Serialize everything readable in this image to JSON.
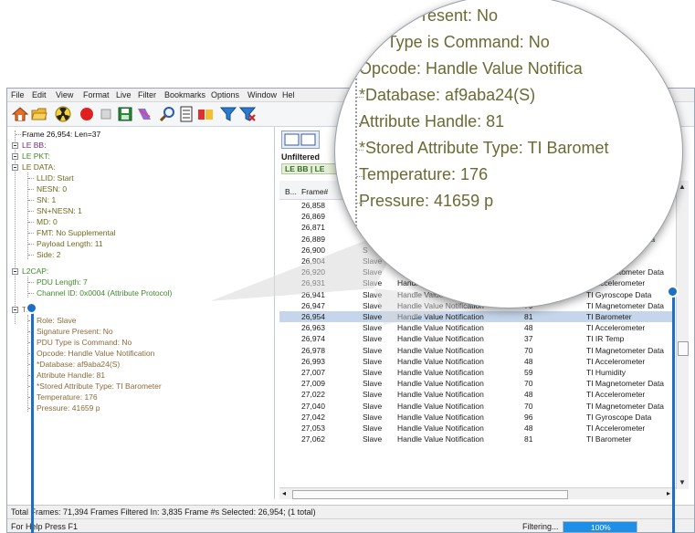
{
  "menu": [
    "File",
    "Edit",
    "View",
    "Format",
    "Live",
    "Filter",
    "Bookmarks",
    "Options",
    "Window",
    "Hel"
  ],
  "tree": {
    "frame": "Frame 26,954:  Len=37",
    "le_bb": "LE BB:",
    "le_pkt": "LE PKT:",
    "le_data": "LE DATA:",
    "le_data_children": [
      "LLID: Start",
      "NESN: 0",
      "SN: 1",
      "SN+NESN: 1",
      "MD: 0",
      "FMT: No Supplemental",
      "Payload Length: 11",
      "Side: 2"
    ],
    "l2cap": "L2CAP:",
    "l2cap_children": [
      "PDU Length: 7",
      "Channel ID: 0x0004  (Attribute Protocol)"
    ],
    "att": "T:",
    "att_children": [
      "Role: Slave",
      "Signature Present: No",
      "PDU Type is Command: No",
      "Opcode: Handle Value Notification",
      "*Database: af9aba24(S)",
      "Attribute Handle: 81",
      "*Stored Attribute Type: TI Barometer",
      "Temperature: 176",
      "Pressure: 41659 p"
    ]
  },
  "tabs": {
    "unfiltered": "Unfiltered",
    "sub": "LE BB | LE"
  },
  "grid": {
    "headers": {
      "b": "B...",
      "frame": "Frame#"
    },
    "rows": [
      {
        "frame": "26,858",
        "role": "",
        "opcode": "",
        "handle": "",
        "type": "gnetometer Data"
      },
      {
        "frame": "26,869",
        "role": "",
        "opcode": "",
        "handle": "",
        "type": "ccelerometer"
      },
      {
        "frame": "26,871",
        "role": "",
        "opcode": "",
        "handle": "",
        "type": "Temp"
      },
      {
        "frame": "26,889",
        "role": "",
        "opcode": "",
        "handle": "",
        "type": "Magnetometer Data"
      },
      {
        "frame": "26,900",
        "role": "S",
        "opcode": "",
        "handle": "",
        "type": "Accelerometer"
      },
      {
        "frame": "26,904",
        "role": "Slave",
        "opcode": "",
        "handle": "",
        "type": "TI Humidity"
      },
      {
        "frame": "26,920",
        "role": "Slave",
        "opcode": "",
        "handle": "",
        "type": "TI Magnetometer Data"
      },
      {
        "frame": "26,931",
        "role": "Slave",
        "opcode": "Handle",
        "handle": "48",
        "type": "TI Accelerometer"
      },
      {
        "frame": "26,941",
        "role": "Slave",
        "opcode": "Handle Value Notification",
        "handle": "96",
        "type": "TI Gyroscope Data"
      },
      {
        "frame": "26,947",
        "role": "Slave",
        "opcode": "Handle Value Notification",
        "handle": "70",
        "type": "TI Magnetometer Data"
      },
      {
        "frame": "26,954",
        "role": "Slave",
        "opcode": "Handle Value Notification",
        "handle": "81",
        "type": "TI Barometer"
      },
      {
        "frame": "26,963",
        "role": "Slave",
        "opcode": "Handle Value Notification",
        "handle": "48",
        "type": "TI Accelerometer"
      },
      {
        "frame": "26,974",
        "role": "Slave",
        "opcode": "Handle Value Notification",
        "handle": "37",
        "type": "TI IR Temp"
      },
      {
        "frame": "26,978",
        "role": "Slave",
        "opcode": "Handle Value Notification",
        "handle": "70",
        "type": "TI Magnetometer Data"
      },
      {
        "frame": "26,993",
        "role": "Slave",
        "opcode": "Handle Value Notification",
        "handle": "48",
        "type": "TI Accelerometer"
      },
      {
        "frame": "27,007",
        "role": "Slave",
        "opcode": "Handle Value Notification",
        "handle": "59",
        "type": "TI Humidity"
      },
      {
        "frame": "27,009",
        "role": "Slave",
        "opcode": "Handle Value Notification",
        "handle": "70",
        "type": "TI Magnetometer Data"
      },
      {
        "frame": "27,022",
        "role": "Slave",
        "opcode": "Handle Value Notification",
        "handle": "48",
        "type": "TI Accelerometer"
      },
      {
        "frame": "27,040",
        "role": "Slave",
        "opcode": "Handle Value Notification",
        "handle": "70",
        "type": "TI Magnetometer Data"
      },
      {
        "frame": "27,042",
        "role": "Slave",
        "opcode": "Handle Value Notification",
        "handle": "96",
        "type": "TI Gyroscope Data"
      },
      {
        "frame": "27,053",
        "role": "Slave",
        "opcode": "Handle Value Notification",
        "handle": "48",
        "type": "TI Accelerometer"
      },
      {
        "frame": "27,062",
        "role": "Slave",
        "opcode": "Handle Value Notification",
        "handle": "81",
        "type": "TI Barometer"
      }
    ],
    "selected_frame": "26,954"
  },
  "status": "Total Frames:  71,394  Frames Filtered In:  3,835  Frame #s Selected:  26,954; (1 total)",
  "help": "For Help Press F1",
  "filtering": "Filtering...",
  "progress": "100%",
  "progress_value": 1.0,
  "magnifier": [
    "ure Present: No",
    "DU Type is Command: No",
    "Opcode: Handle Value Notifica",
    "*Database: af9aba24(S)",
    "Attribute Handle: 81",
    "*Stored Attribute Type: TI Baromet",
    "Temperature: 176",
    "Pressure: 41659 p"
  ],
  "colors": {
    "accent": "#1d6fc6",
    "selected_row": "#c5d6ec",
    "tree_olive": "#6c6a1e",
    "tree_green": "#3f8a2a"
  }
}
